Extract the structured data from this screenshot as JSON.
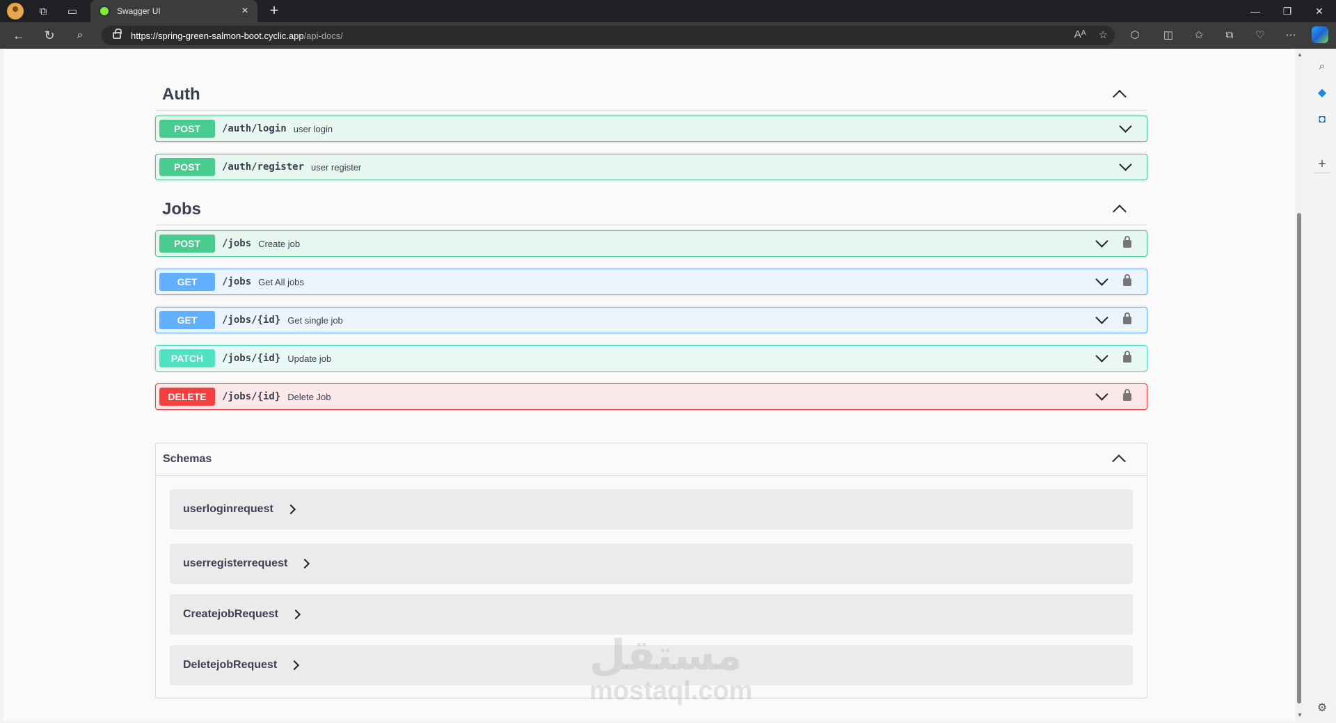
{
  "browser": {
    "tab_title": "Swagger UI",
    "url_host": "https://spring-green-salmon-boot.cyclic.app",
    "url_path": "/api-docs/",
    "new_tab": "+",
    "close_tab": "×",
    "window_controls": [
      "—",
      "❐",
      "✕"
    ]
  },
  "sections": [
    {
      "title": "Auth",
      "operations": [
        {
          "method": "POST",
          "path": "/auth/login",
          "summary": "user login",
          "locked": false
        },
        {
          "method": "POST",
          "path": "/auth/register",
          "summary": "user register",
          "locked": false
        }
      ]
    },
    {
      "title": "Jobs",
      "operations": [
        {
          "method": "POST",
          "path": "/jobs",
          "summary": "Create job",
          "locked": true
        },
        {
          "method": "GET",
          "path": "/jobs",
          "summary": "Get All jobs",
          "locked": true
        },
        {
          "method": "GET",
          "path": "/jobs/{id}",
          "summary": "Get single job",
          "locked": true
        },
        {
          "method": "PATCH",
          "path": "/jobs/{id}",
          "summary": "Update job",
          "locked": true
        },
        {
          "method": "DELETE",
          "path": "/jobs/{id}",
          "summary": "Delete Job",
          "locked": true
        }
      ]
    }
  ],
  "schemas": {
    "title": "Schemas",
    "models": [
      "userloginrequest",
      "userregisterrequest",
      "CreatejobRequest",
      "DeletejobRequest"
    ]
  },
  "watermark": {
    "arabic": "مستقل",
    "latin": "mostaql.com"
  },
  "colors": {
    "post": "#49cc90",
    "get": "#61affe",
    "patch": "#50e3c2",
    "delete": "#f93e3e"
  }
}
